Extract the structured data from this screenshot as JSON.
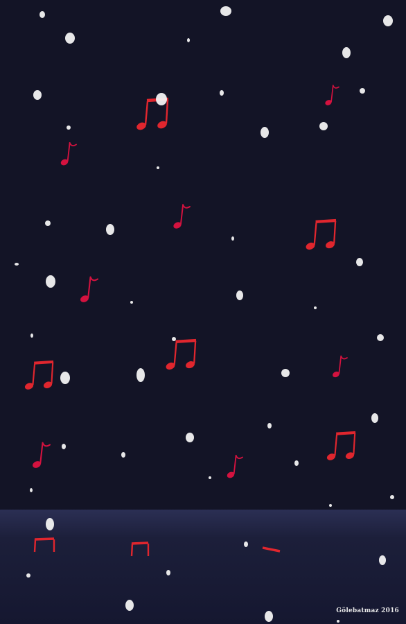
{
  "scene": {
    "description_visible": false,
    "colors": {
      "sky": "#131426",
      "ground": "#1a1d36",
      "horizon": "#2a2e52",
      "snow": "#f2f2f2",
      "note_red": "#e0262e",
      "note_crimson": "#d4123f"
    }
  },
  "signature": {
    "text": "Gölebatmaz 2016"
  }
}
